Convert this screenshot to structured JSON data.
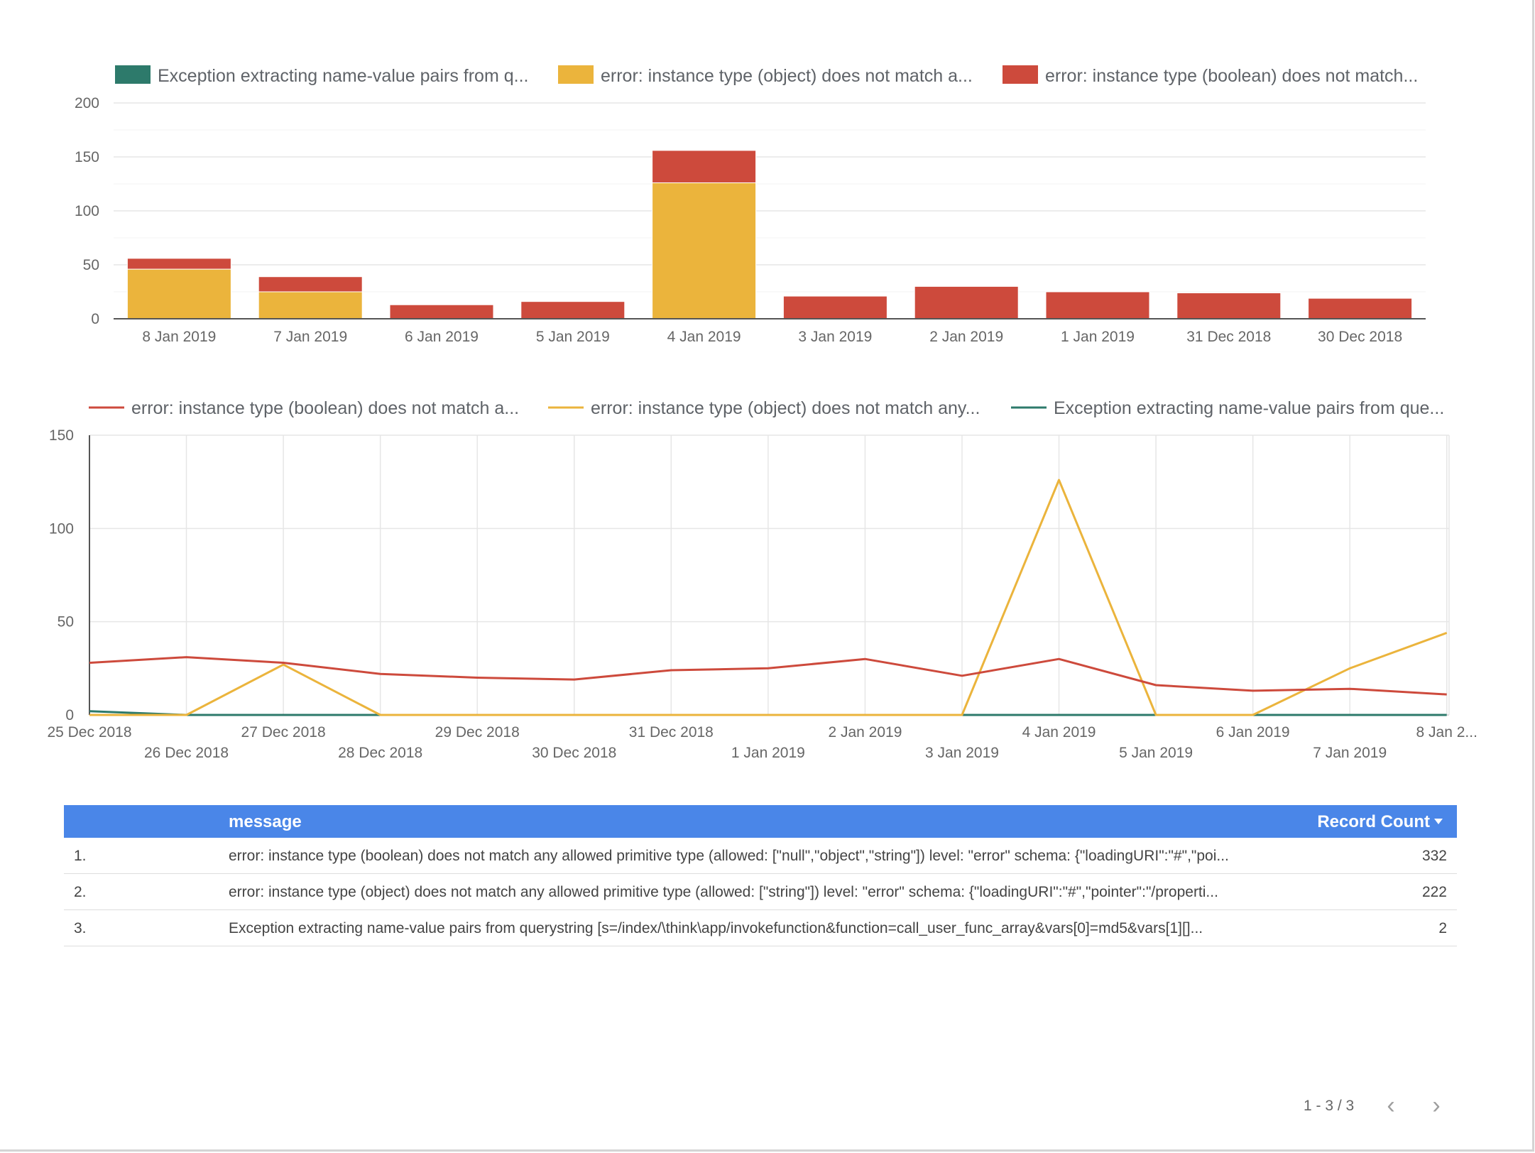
{
  "colors": {
    "teal": "#2d7a6b",
    "yellow": "#ebb43c",
    "red": "#cd4a3c",
    "header": "#4a86e8"
  },
  "bar_legend": [
    {
      "label": "Exception extracting name-value pairs from q...",
      "color": "#2d7a6b"
    },
    {
      "label": "error: instance type (object) does not match a...",
      "color": "#ebb43c"
    },
    {
      "label": "error: instance type (boolean) does not match...",
      "color": "#cd4a3c"
    }
  ],
  "line_legend": [
    {
      "label": "error: instance type (boolean) does not match a...",
      "color": "#cd4a3c"
    },
    {
      "label": "error: instance type (object) does not match any...",
      "color": "#ebb43c"
    },
    {
      "label": "Exception extracting name-value pairs from que...",
      "color": "#2d7a6b"
    }
  ],
  "chart_data": [
    {
      "type": "bar",
      "stacked": true,
      "categories": [
        "8 Jan 2019",
        "7 Jan 2019",
        "6 Jan 2019",
        "5 Jan 2019",
        "4 Jan 2019",
        "3 Jan 2019",
        "2 Jan 2019",
        "1 Jan 2019",
        "31 Dec 2018",
        "30 Dec 2018"
      ],
      "series": [
        {
          "name": "Exception extracting name-value pairs from q...",
          "color": "#2d7a6b",
          "values": [
            0,
            0,
            0,
            0,
            0,
            0,
            0,
            0,
            0,
            0
          ]
        },
        {
          "name": "error: instance type (object) does not match a...",
          "color": "#ebb43c",
          "values": [
            46,
            25,
            0,
            0,
            126,
            0,
            0,
            0,
            0,
            0
          ]
        },
        {
          "name": "error: instance type (boolean) does not match...",
          "color": "#cd4a3c",
          "values": [
            10,
            14,
            13,
            16,
            30,
            21,
            30,
            25,
            24,
            19
          ]
        }
      ],
      "yticks": [
        0,
        50,
        100,
        150,
        200
      ],
      "ylim": [
        0,
        200
      ],
      "grid": true,
      "legend_position": "top"
    },
    {
      "type": "line",
      "x": [
        "25 Dec 2018",
        "26 Dec 2018",
        "27 Dec 2018",
        "28 Dec 2018",
        "29 Dec 2018",
        "30 Dec 2018",
        "31 Dec 2018",
        "1 Jan 2019",
        "2 Jan 2019",
        "3 Jan 2019",
        "4 Jan 2019",
        "5 Jan 2019",
        "6 Jan 2019",
        "7 Jan 2019",
        "8 Jan 2..."
      ],
      "series": [
        {
          "name": "error: instance type (boolean) does not match a...",
          "color": "#cd4a3c",
          "values": [
            28,
            31,
            28,
            22,
            20,
            19,
            24,
            25,
            30,
            21,
            30,
            16,
            13,
            14,
            11
          ]
        },
        {
          "name": "error: instance type (object) does not match any...",
          "color": "#ebb43c",
          "values": [
            0,
            0,
            27,
            0,
            0,
            0,
            0,
            0,
            0,
            0,
            126,
            0,
            0,
            25,
            44
          ]
        },
        {
          "name": "Exception extracting name-value pairs from que...",
          "color": "#2d7a6b",
          "values": [
            2,
            0,
            0,
            0,
            0,
            0,
            0,
            0,
            0,
            0,
            0,
            0,
            0,
            0,
            0
          ]
        }
      ],
      "yticks": [
        0,
        50,
        100,
        150
      ],
      "ylim": [
        0,
        150
      ],
      "grid": true,
      "legend_position": "top"
    }
  ],
  "table": {
    "header_message": "message",
    "header_count": "Record Count",
    "rows": [
      {
        "index": "1.",
        "message": "error: instance type (boolean) does not match any allowed primitive type (allowed: [\"null\",\"object\",\"string\"]) level: \"error\" schema: {\"loadingURI\":\"#\",\"poi...",
        "count": "332"
      },
      {
        "index": "2.",
        "message": "error: instance type (object) does not match any allowed primitive type (allowed: [\"string\"]) level: \"error\" schema: {\"loadingURI\":\"#\",\"pointer\":\"/properti...",
        "count": "222"
      },
      {
        "index": "3.",
        "message": "Exception extracting name-value pairs from querystring [s=/index/\\think\\app/invokefunction&function=call_user_func_array&vars[0]=md5&vars[1][]...",
        "count": "2"
      }
    ]
  },
  "pager": {
    "range": "1 - 3 / 3",
    "prev_icon": "‹",
    "next_icon": "›"
  }
}
